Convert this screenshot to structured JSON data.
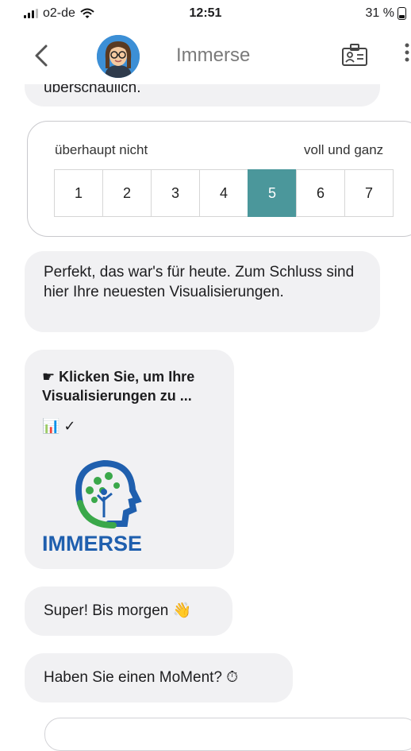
{
  "status_bar": {
    "carrier": "o2-de",
    "time": "12:51",
    "battery": "31 %"
  },
  "header": {
    "title": "Immerse"
  },
  "messages": {
    "cut_off_text": "überschaulich.",
    "scale": {
      "low_label": "überhaupt nicht",
      "high_label": "voll und ganz",
      "options": [
        "1",
        "2",
        "3",
        "4",
        "5",
        "6",
        "7"
      ],
      "selected": "5"
    },
    "perfect": "Perfekt, das war's für heute. Zum Schluss sind hier Ihre neuesten Visualisierungen.",
    "link_card": {
      "title": "☛ Klicken Sie, um Ihre Visualisierungen zu ...",
      "emojis": "📊 ✓",
      "logo_text": "IMMERSE"
    },
    "bye": "Super! Bis morgen 👋",
    "moment": "Haben Sie einen MoMent? ⏱"
  },
  "colors": {
    "accent_selected": "#4b979b",
    "bubble": "#f1f1f3",
    "logo_blue": "#1f5fae",
    "logo_green": "#3aa84a"
  }
}
